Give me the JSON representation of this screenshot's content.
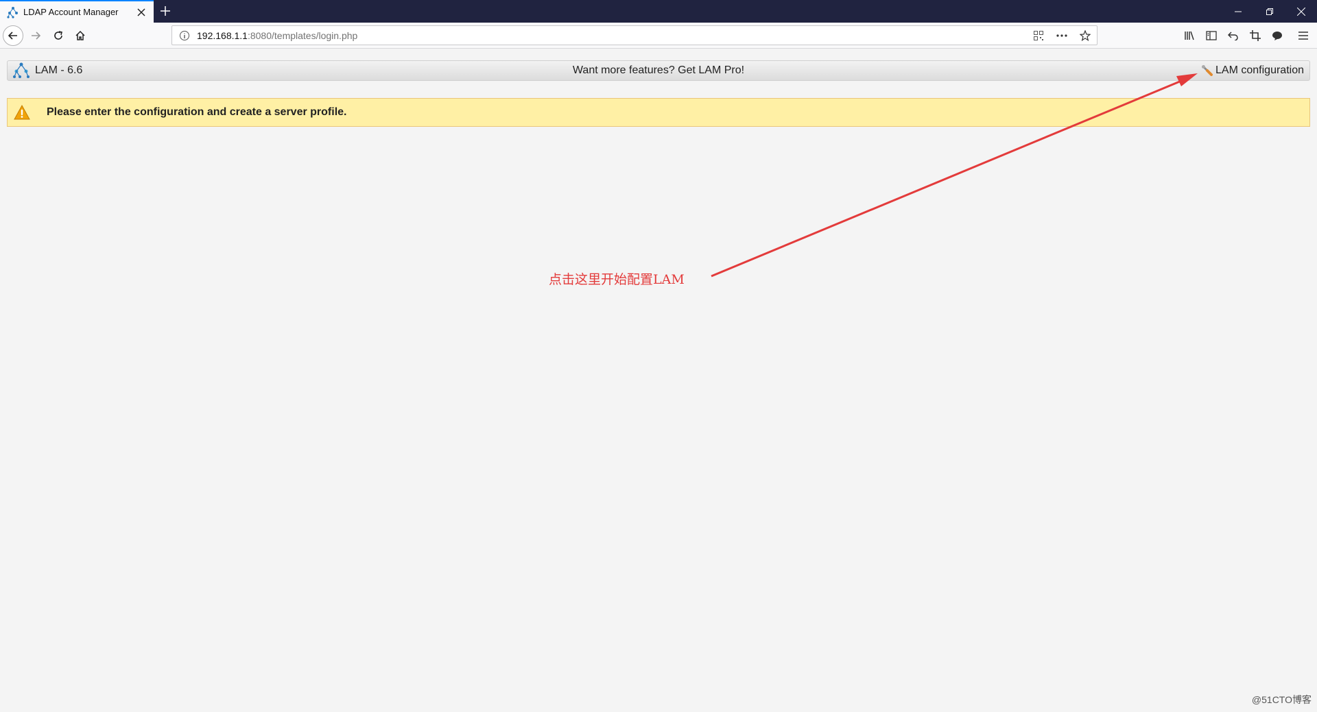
{
  "browser": {
    "tab": {
      "title": "LDAP Account Manager"
    },
    "url": {
      "host": "192.168.1.1",
      "path": ":8080/templates/login.php"
    },
    "colors": {
      "titlebar": "#202340",
      "tab_accent": "#0a84ff"
    }
  },
  "lam": {
    "version": "LAM - 6.6",
    "pro_text": "Want more features? Get LAM Pro!",
    "config_link": "LAM configuration"
  },
  "warning": {
    "message": "Please enter the configuration and create a server profile.",
    "color": "#fff0a5"
  },
  "annotation": {
    "text": "点击这里开始配置LAM",
    "color": "#e33b3b"
  },
  "watermark": "@51CTO博客",
  "icons": [
    "lam-logo-icon",
    "close-icon",
    "plus-icon",
    "minimize-icon",
    "restore-icon",
    "back-icon",
    "forward-icon",
    "reload-icon",
    "home-icon",
    "info-icon",
    "qr-icon",
    "more-icon",
    "star-icon",
    "library-icon",
    "sidebar-icon",
    "undo-icon",
    "crop-icon",
    "chat-icon",
    "menu-icon",
    "wrench-icon",
    "warning-icon"
  ]
}
